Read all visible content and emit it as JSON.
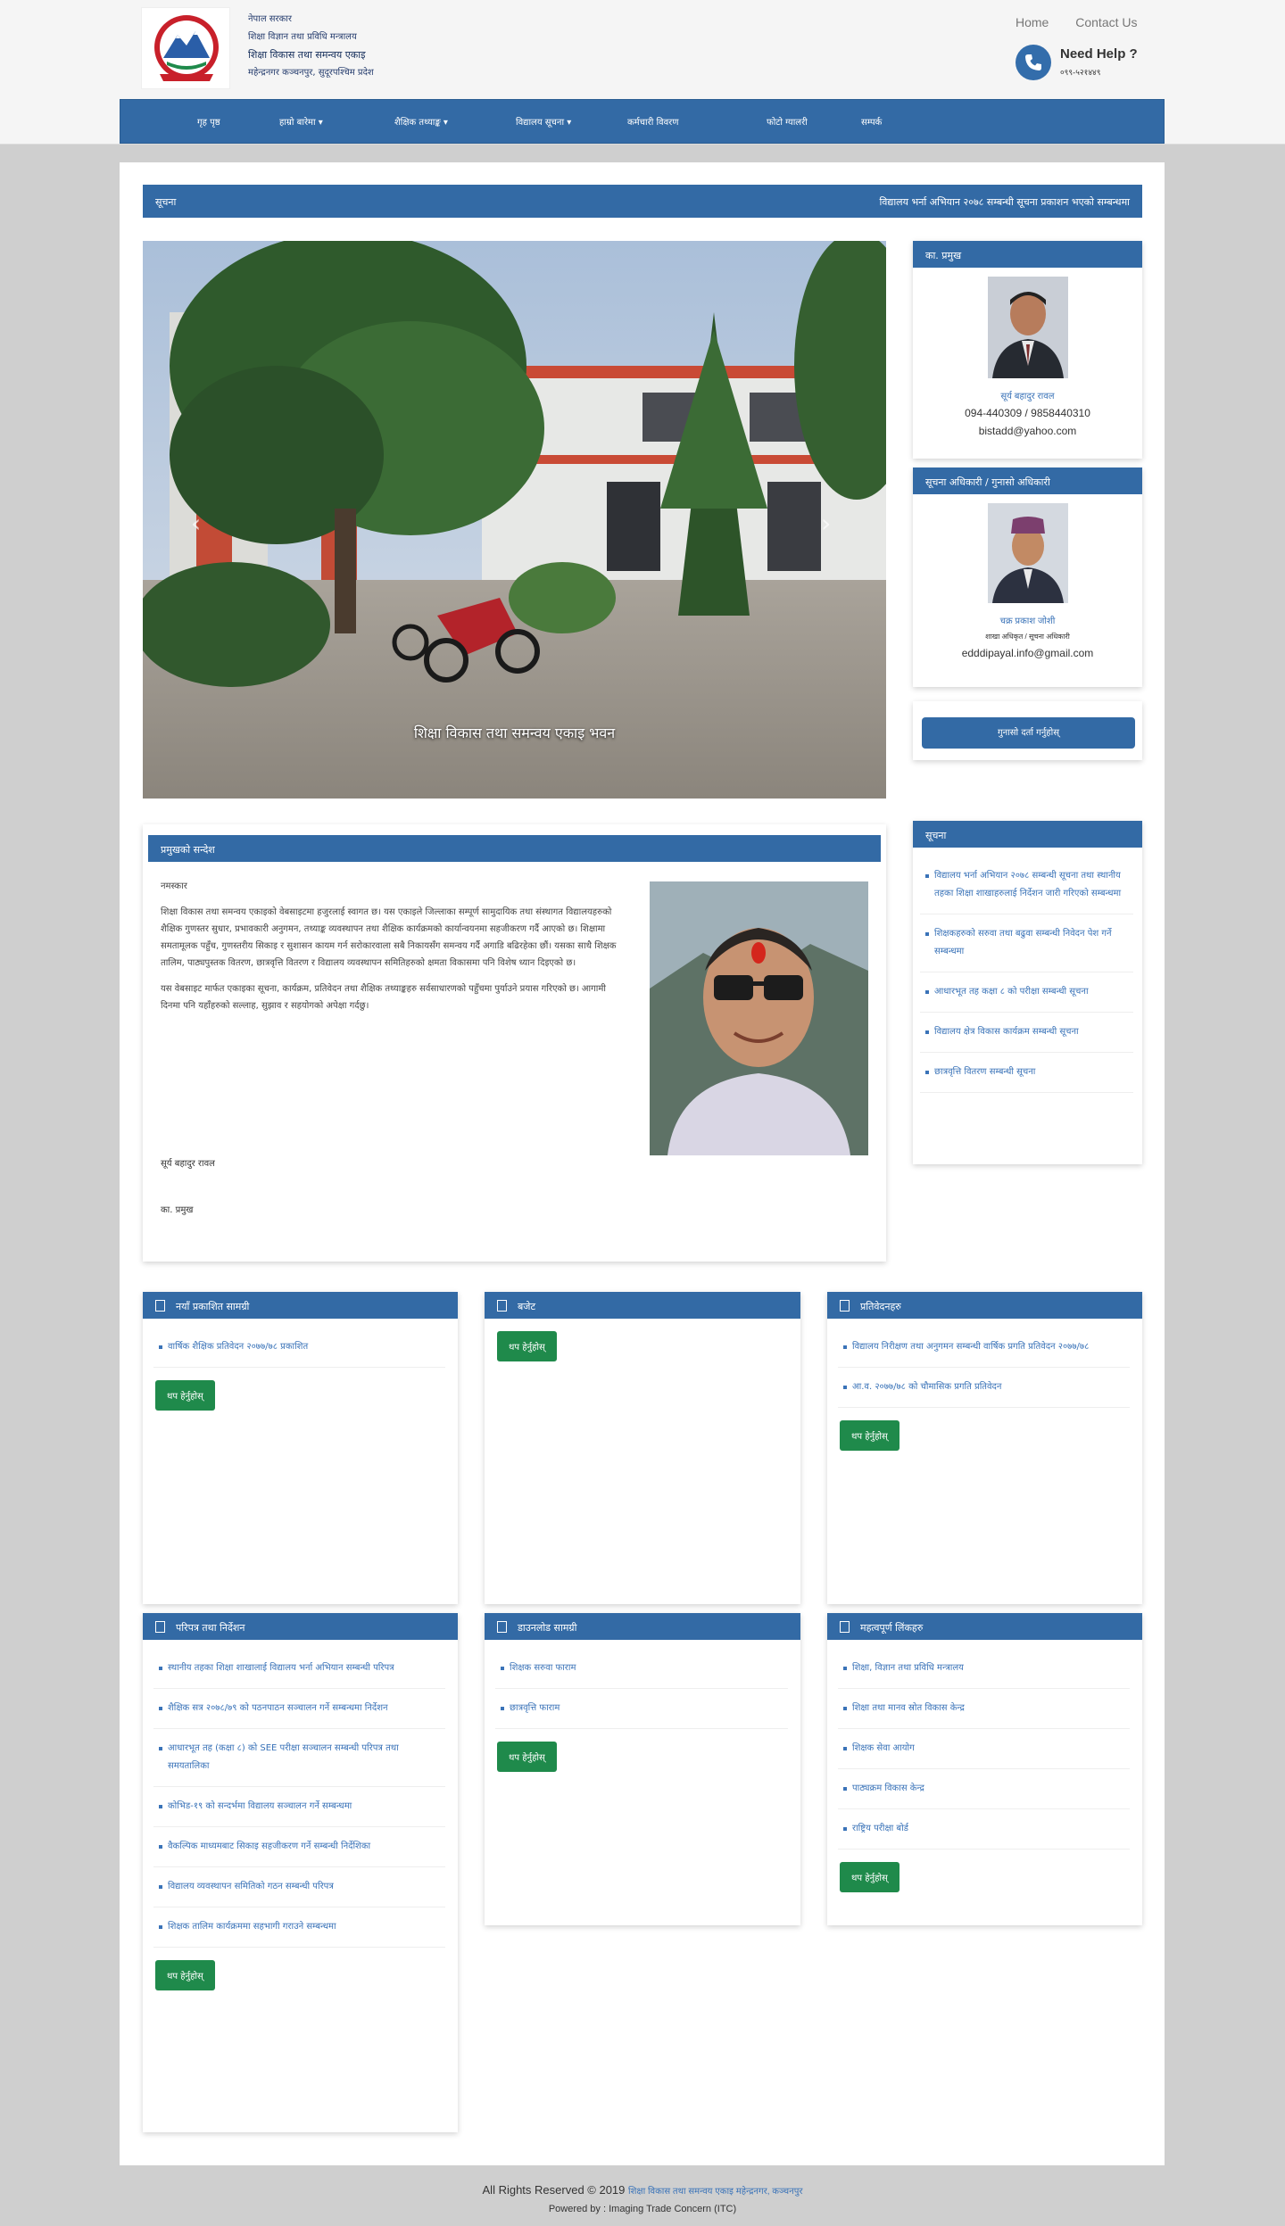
{
  "header": {
    "org_line1": "नेपाल सरकार",
    "org_line2": "शिक्षा विज्ञान तथा प्रविधि मन्त्रालय",
    "org_line3": "शिक्षा विकास तथा समन्वय एकाइ",
    "org_line4": "महेन्द्रनगर कञ्चनपुर, सुदूरपश्चिम प्रदेश",
    "home": "Home",
    "contact": "Contact Us",
    "help_title": "Need Help ?",
    "help_phone": "०९९-५२१४४९",
    "phone_icon": "phone-icon"
  },
  "nav": [
    {
      "label": "गृह पृष्ठ",
      "dropdown": false
    },
    {
      "label": "हाम्रो बारेमा",
      "dropdown": true
    },
    {
      "label": "शैक्षिक तथ्याङ्क",
      "dropdown": true
    },
    {
      "label": "विद्यालय सूचना",
      "dropdown": true
    },
    {
      "label": "कर्मचारी विवरण",
      "dropdown": false
    },
    {
      "label": "फोटो ग्यालरी",
      "dropdown": false
    },
    {
      "label": "सम्पर्क",
      "dropdown": false
    }
  ],
  "ticker": {
    "label": "सूचना",
    "text": "विद्यालय भर्ना अभियान २०७८ सम्बन्धी सूचना प्रकाशन भएको सम्बन्धमा"
  },
  "slider": {
    "caption": "शिक्षा विकास तथा समन्वय एकाइ भवन",
    "prev": "‹",
    "next": "›"
  },
  "officer1": {
    "heading": "का. प्रमुख",
    "name": "सूर्य बहादुर रावल",
    "phone": "094-440309 / 9858440310",
    "email": "bistadd@yahoo.com"
  },
  "officer2": {
    "heading": "सूचना अधिकारी / गुनासो अधिकारी",
    "name": "चक्र प्रकाश जोशी",
    "role": "शाखा अधिकृत / सूचना अधिकारी",
    "email": "edddipayal.info@gmail.com"
  },
  "complaint_button": "गुनासो दर्ता गर्नुहोस्",
  "welcome": {
    "heading": "प्रमुखको सन्देश",
    "greeting": "नमस्कार",
    "para1": "शिक्षा विकास तथा समन्वय एकाइको वेबसाइटमा हजुरलाई स्वागत छ। यस एकाइले जिल्लाका सम्पूर्ण सामुदायिक तथा संस्थागत विद्यालयहरुको शैक्षिक गुणस्तर सुधार, प्रभावकारी अनुगमन, तथ्याङ्क व्यवस्थापन तथा शैक्षिक कार्यक्रमको कार्यान्वयनमा सहजीकरण गर्दै आएको छ। शिक्षामा समतामूलक पहुँच, गुणस्तरीय सिकाइ र सुशासन कायम गर्न सरोकारवाला सबै निकायसँग समन्वय गर्दै अगाडि बढिरहेका छौं। यसका साथै शिक्षक तालिम, पाठ्यपुस्तक वितरण, छात्रवृत्ति वितरण र विद्यालय व्यवस्थापन समितिहरुको क्षमता विकासमा पनि विशेष ध्यान दिइएको छ।",
    "para2": "यस वेबसाइट मार्फत एकाइका सूचना, कार्यक्रम, प्रतिवेदन तथा शैक्षिक तथ्याङ्कहरु सर्वसाधारणको पहुँचमा पुर्याउने प्रयास गरिएको छ। आगामी दिनमा पनि यहाँहरुको सल्लाह, सुझाव र सहयोगको अपेक्षा गर्दछु।",
    "sign_name": "सूर्य बहादुर रावल",
    "sign_title": "का. प्रमुख"
  },
  "notices": {
    "heading": "सूचना",
    "items": [
      "विद्यालय भर्ना अभियान २०७८ सम्बन्धी सूचना तथा स्थानीय तहका शिक्षा शाखाहरुलाई निर्देशन जारी गरिएको सम्बन्धमा",
      "शिक्षकहरुको सरुवा तथा बढुवा सम्बन्धी निवेदन पेश गर्ने सम्बन्धमा",
      "आधारभूत तह कक्षा ८ को परीक्षा सम्बन्धी सूचना",
      "विद्यालय क्षेत्र विकास कार्यक्रम सम्बन्धी सूचना",
      "छात्रवृत्ति वितरण सम्बन्धी सूचना"
    ],
    "more": "थप हेर्नुहोस्"
  },
  "boxes": [
    {
      "heading": "नयाँ प्रकाशित सामग्री",
      "items": [
        "वार्षिक शैक्षिक प्रतिवेदन २०७७/७८ प्रकाशित"
      ],
      "more": "थप हेर्नुहोस्"
    },
    {
      "heading": "बजेट",
      "items": [],
      "more": "थप हेर्नुहोस्"
    },
    {
      "heading": "प्रतिवेदनहरु",
      "items": [
        "विद्यालय निरीक्षण तथा अनुगमन सम्बन्धी वार्षिक प्रगति प्रतिवेदन २०७७/७८",
        "आ.व. २०७७/७८ को चौमासिक प्रगति प्रतिवेदन"
      ],
      "more": "थप हेर्नुहोस्"
    },
    {
      "heading": "परिपत्र तथा निर्देशन",
      "items": [
        "स्थानीय तहका शिक्षा शाखालाई विद्यालय भर्ना अभियान सम्बन्धी परिपत्र",
        "शैक्षिक सत्र २०७८/७९ को पठनपाठन सञ्चालन गर्ने सम्बन्धमा निर्देशन",
        "आधारभूत तह (कक्षा ८) को SEE परीक्षा सञ्चालन सम्बन्धी परिपत्र तथा समयतालिका",
        "कोभिड-१९ को सन्दर्भमा विद्यालय सञ्चालन गर्ने सम्बन्धमा",
        "वैकल्पिक माध्यमबाट सिकाइ सहजीकरण गर्ने सम्बन्धी निर्देशिका",
        "विद्यालय व्यवस्थापन समितिको गठन सम्बन्धी परिपत्र",
        "शिक्षक तालिम कार्यक्रममा सहभागी गराउने सम्बन्धमा"
      ],
      "more": "थप हेर्नुहोस्"
    },
    {
      "heading": "डाउनलोड सामग्री",
      "items": [
        "शिक्षक सरुवा फाराम",
        "छात्रवृत्ति फाराम"
      ],
      "more": "थप हेर्नुहोस्"
    },
    {
      "heading": "महत्वपूर्ण लिंकहरु",
      "items": [
        "शिक्षा, विज्ञान तथा प्रविधि मन्त्रालय",
        "शिक्षा तथा मानव स्रोत विकास केन्द्र",
        "शिक्षक सेवा आयोग",
        "पाठ्यक्रम विकास केन्द्र",
        "राष्ट्रिय परीक्षा बोर्ड"
      ],
      "more": "थप हेर्नुहोस्"
    }
  ],
  "footer": {
    "rights": "All Rights Reserved © 2019",
    "org": "शिक्षा विकास तथा समन्वय एकाइ महेन्द्रनगर, कञ्चनपुर",
    "powered_label": "Powered by :",
    "powered_by": "Imaging Trade Concern (ITC)"
  }
}
